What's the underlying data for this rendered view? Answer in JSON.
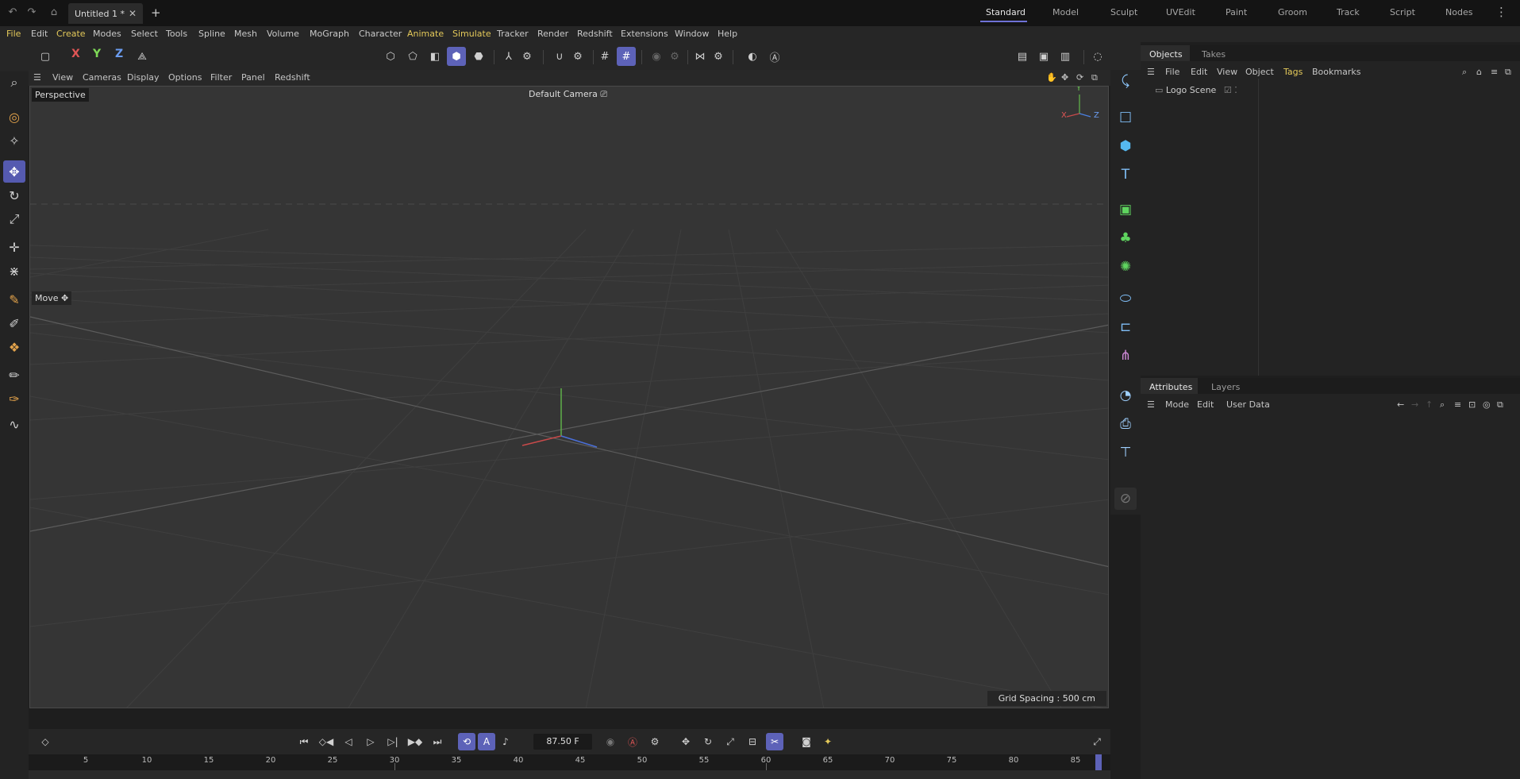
{
  "titlebar": {
    "doc_tab": "Untitled 1 *",
    "layouts": [
      "Standard",
      "Model",
      "Sculpt",
      "UVEdit",
      "Paint",
      "Groom",
      "Track",
      "Script",
      "Nodes"
    ]
  },
  "menubar": [
    "File",
    "Edit",
    "Create",
    "Modes",
    "Select",
    "Tools",
    "Spline",
    "Mesh",
    "Volume",
    "MoGraph",
    "Character",
    "Animate",
    "Simulate",
    "Tracker",
    "Render",
    "Redshift",
    "Extensions",
    "Window",
    "Help"
  ],
  "toolbar": {
    "axis_x": "X",
    "axis_y": "Y",
    "axis_z": "Z"
  },
  "viewport": {
    "menu": [
      "View",
      "Cameras",
      "Display",
      "Options",
      "Filter",
      "Panel",
      "Redshift"
    ],
    "label": "Perspective",
    "camera": "Default Camera",
    "hud_tool": "Move",
    "grid_spacing": "Grid Spacing : 500 cm",
    "gizmo": {
      "x": "X",
      "y": "Y",
      "z": "Z"
    }
  },
  "objects": {
    "tabs": [
      "Objects",
      "Takes"
    ],
    "menu": [
      "File",
      "Edit",
      "View",
      "Object",
      "Tags",
      "Bookmarks"
    ],
    "items": [
      {
        "name": "Logo Scene"
      }
    ]
  },
  "attributes": {
    "tabs": [
      "Attributes",
      "Layers"
    ],
    "menu": [
      "Mode",
      "Edit",
      "User Data"
    ]
  },
  "timeline": {
    "current_frame": "87.50 F",
    "ticks": [
      "5",
      "10",
      "15",
      "20",
      "25",
      "30",
      "35",
      "40",
      "45",
      "50",
      "55",
      "60",
      "65",
      "70",
      "75",
      "80",
      "85"
    ]
  },
  "colors": {
    "accent": "#5d62b8",
    "highlight_menu": "#e4c95a",
    "viewport_bg": "#353535"
  }
}
